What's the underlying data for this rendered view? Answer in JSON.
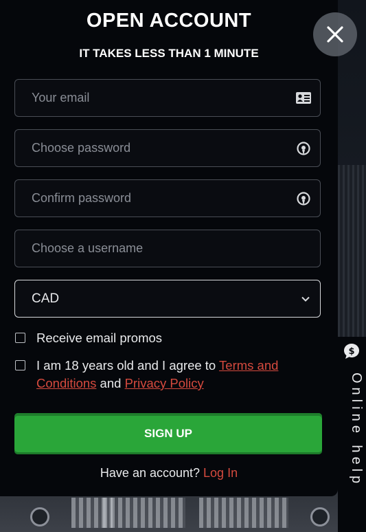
{
  "modal": {
    "title": "OPEN ACCOUNT",
    "subtitle": "IT TAKES LESS THAN 1 MINUTE"
  },
  "form": {
    "email_placeholder": "Your email",
    "password_placeholder": "Choose password",
    "confirm_placeholder": "Confirm password",
    "username_placeholder": "Choose a username",
    "currency_value": "CAD",
    "promos_label": "Receive email promos",
    "agree_prefix": "I am 18 years old and I agree to ",
    "terms_link": "Terms and Conditions",
    "agree_mid": " and ",
    "privacy_link": "Privacy Policy",
    "signup_label": "SIGN UP",
    "have_account": "Have an account? ",
    "login_link": "Log In"
  },
  "help": {
    "label": "Online help"
  },
  "colors": {
    "accent_green": "#2aa639",
    "link_red": "#d64a3e",
    "panel": "#05070b"
  },
  "icons": [
    "id-card-icon",
    "password-eye-icon",
    "chevron-down-icon",
    "close-icon",
    "chat-help-icon"
  ]
}
